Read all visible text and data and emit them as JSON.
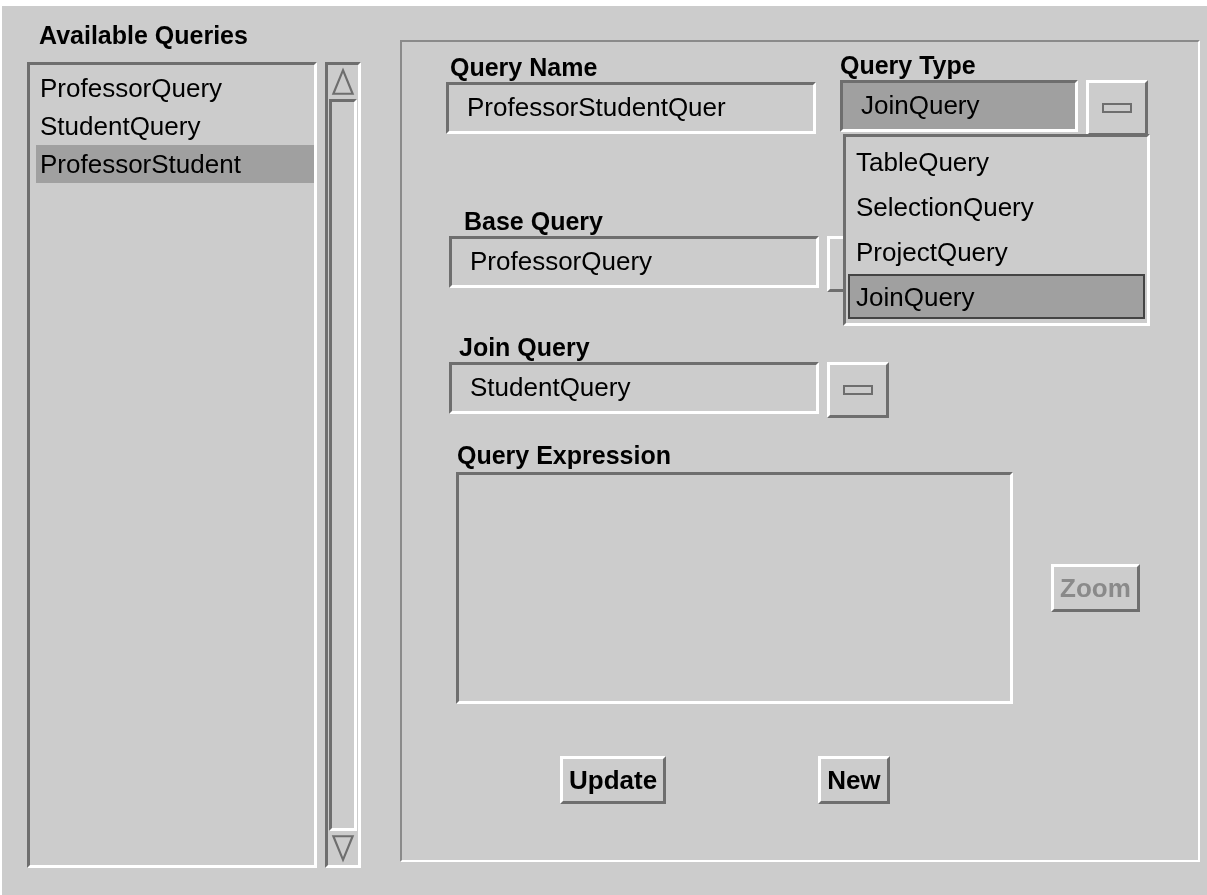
{
  "available_queries": {
    "title": "Available Queries",
    "items": [
      {
        "label": "ProfessorQuery",
        "selected": false
      },
      {
        "label": "StudentQuery",
        "selected": false
      },
      {
        "label": "ProfessorStudent",
        "selected": true
      }
    ]
  },
  "query_name": {
    "label": "Query Name",
    "value": "ProfessorStudentQuer"
  },
  "query_type": {
    "label": "Query Type",
    "value": "JoinQuery",
    "expanded": true,
    "options": [
      {
        "label": "TableQuery",
        "selected": false
      },
      {
        "label": "SelectionQuery",
        "selected": false
      },
      {
        "label": "ProjectQuery",
        "selected": false
      },
      {
        "label": "JoinQuery",
        "selected": true
      }
    ]
  },
  "base_query": {
    "label": "Base Query",
    "value": "ProfessorQuery"
  },
  "join_query": {
    "label": "Join Query",
    "value": "StudentQuery"
  },
  "query_expression": {
    "label": "Query Expression"
  },
  "zoom_button": {
    "label": "Zoom",
    "disabled": true
  },
  "buttons": [
    {
      "label": "Update",
      "disabled": false
    },
    {
      "label": "New",
      "disabled": false
    }
  ]
}
